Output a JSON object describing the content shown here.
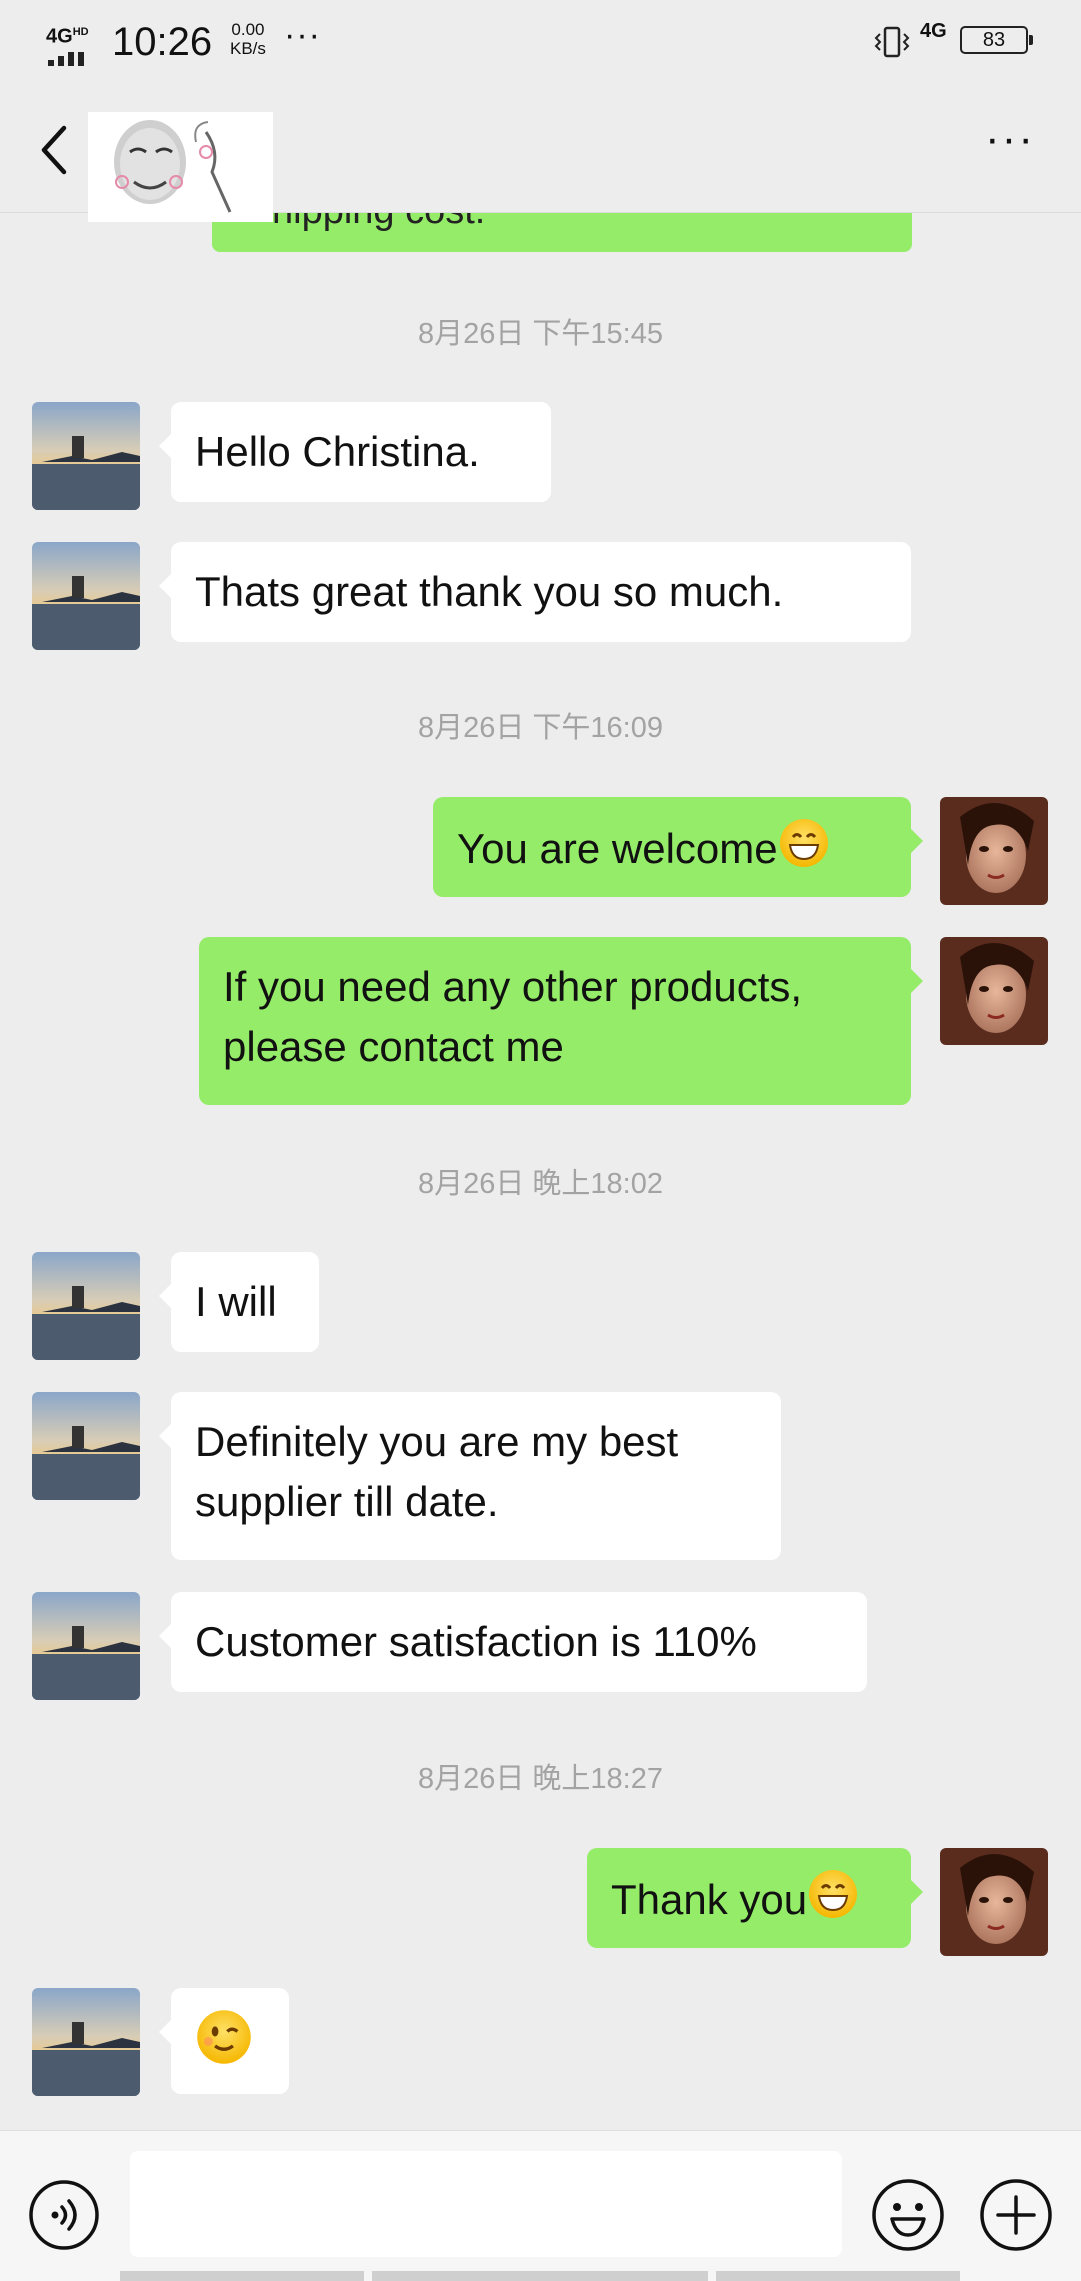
{
  "status_bar": {
    "network_left": "4G",
    "network_left_sup": "HD",
    "time": "10:26",
    "speed_value": "0.00",
    "speed_unit": "KB/s",
    "more_dots": "···",
    "network_right": "4G",
    "battery": "83"
  },
  "header": {
    "back_icon": "chevron-left-icon",
    "more_label": "···"
  },
  "chat": {
    "partial_message": "hipping cost.",
    "timestamps": [
      "8月26日 下午15:45",
      "8月26日 下午16:09",
      "8月26日 晚上18:02",
      "8月26日 晚上18:27"
    ],
    "messages": [
      {
        "sender": "contact",
        "text": "Hello Christina."
      },
      {
        "sender": "contact",
        "text": "Thats great thank you so much."
      },
      {
        "sender": "me",
        "text": "You are welcome",
        "emoji": "grin-emoji"
      },
      {
        "sender": "me",
        "line1": "If you need any other products,",
        "line2": "please contact me"
      },
      {
        "sender": "contact",
        "text": "I will"
      },
      {
        "sender": "contact",
        "line1": "Definitely you are my best",
        "line2": "supplier till date."
      },
      {
        "sender": "contact",
        "text": "Customer satisfaction is 110%"
      },
      {
        "sender": "me",
        "text": "Thank you",
        "emoji": "grin-emoji"
      },
      {
        "sender": "contact",
        "emoji": "wink-emoji"
      }
    ]
  },
  "input_bar": {
    "voice_icon": "voice-icon",
    "emoji_icon": "emoji-icon",
    "plus_icon": "plus-icon",
    "text_value": ""
  },
  "colors": {
    "background": "#ededed",
    "outgoing_bubble": "#95ec69",
    "incoming_bubble": "#ffffff",
    "timestamp": "#a3a3a3"
  }
}
